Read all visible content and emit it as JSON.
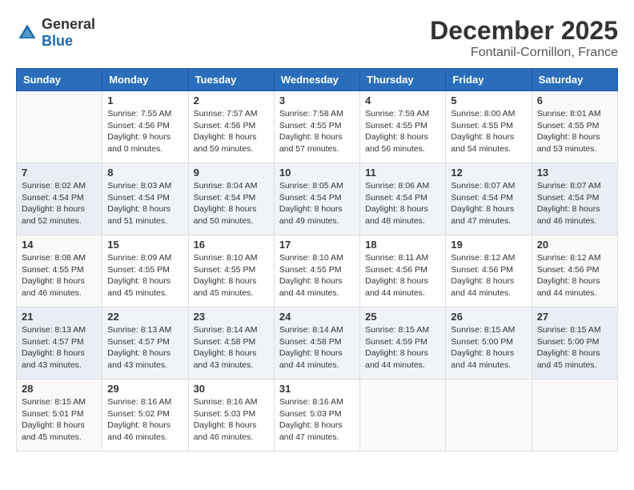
{
  "header": {
    "logo_general": "General",
    "logo_blue": "Blue",
    "title": "December 2025",
    "subtitle": "Fontanil-Cornillon, France"
  },
  "calendar": {
    "weekdays": [
      "Sunday",
      "Monday",
      "Tuesday",
      "Wednesday",
      "Thursday",
      "Friday",
      "Saturday"
    ],
    "rows": [
      [
        {
          "day": "",
          "sunrise": "",
          "sunset": "",
          "daylight": ""
        },
        {
          "day": "1",
          "sunrise": "Sunrise: 7:55 AM",
          "sunset": "Sunset: 4:56 PM",
          "daylight": "Daylight: 9 hours and 0 minutes."
        },
        {
          "day": "2",
          "sunrise": "Sunrise: 7:57 AM",
          "sunset": "Sunset: 4:56 PM",
          "daylight": "Daylight: 8 hours and 59 minutes."
        },
        {
          "day": "3",
          "sunrise": "Sunrise: 7:58 AM",
          "sunset": "Sunset: 4:55 PM",
          "daylight": "Daylight: 8 hours and 57 minutes."
        },
        {
          "day": "4",
          "sunrise": "Sunrise: 7:59 AM",
          "sunset": "Sunset: 4:55 PM",
          "daylight": "Daylight: 8 hours and 56 minutes."
        },
        {
          "day": "5",
          "sunrise": "Sunrise: 8:00 AM",
          "sunset": "Sunset: 4:55 PM",
          "daylight": "Daylight: 8 hours and 54 minutes."
        },
        {
          "day": "6",
          "sunrise": "Sunrise: 8:01 AM",
          "sunset": "Sunset: 4:55 PM",
          "daylight": "Daylight: 8 hours and 53 minutes."
        }
      ],
      [
        {
          "day": "7",
          "sunrise": "Sunrise: 8:02 AM",
          "sunset": "Sunset: 4:54 PM",
          "daylight": "Daylight: 8 hours and 52 minutes."
        },
        {
          "day": "8",
          "sunrise": "Sunrise: 8:03 AM",
          "sunset": "Sunset: 4:54 PM",
          "daylight": "Daylight: 8 hours and 51 minutes."
        },
        {
          "day": "9",
          "sunrise": "Sunrise: 8:04 AM",
          "sunset": "Sunset: 4:54 PM",
          "daylight": "Daylight: 8 hours and 50 minutes."
        },
        {
          "day": "10",
          "sunrise": "Sunrise: 8:05 AM",
          "sunset": "Sunset: 4:54 PM",
          "daylight": "Daylight: 8 hours and 49 minutes."
        },
        {
          "day": "11",
          "sunrise": "Sunrise: 8:06 AM",
          "sunset": "Sunset: 4:54 PM",
          "daylight": "Daylight: 8 hours and 48 minutes."
        },
        {
          "day": "12",
          "sunrise": "Sunrise: 8:07 AM",
          "sunset": "Sunset: 4:54 PM",
          "daylight": "Daylight: 8 hours and 47 minutes."
        },
        {
          "day": "13",
          "sunrise": "Sunrise: 8:07 AM",
          "sunset": "Sunset: 4:54 PM",
          "daylight": "Daylight: 8 hours and 46 minutes."
        }
      ],
      [
        {
          "day": "14",
          "sunrise": "Sunrise: 8:08 AM",
          "sunset": "Sunset: 4:55 PM",
          "daylight": "Daylight: 8 hours and 46 minutes."
        },
        {
          "day": "15",
          "sunrise": "Sunrise: 8:09 AM",
          "sunset": "Sunset: 4:55 PM",
          "daylight": "Daylight: 8 hours and 45 minutes."
        },
        {
          "day": "16",
          "sunrise": "Sunrise: 8:10 AM",
          "sunset": "Sunset: 4:55 PM",
          "daylight": "Daylight: 8 hours and 45 minutes."
        },
        {
          "day": "17",
          "sunrise": "Sunrise: 8:10 AM",
          "sunset": "Sunset: 4:55 PM",
          "daylight": "Daylight: 8 hours and 44 minutes."
        },
        {
          "day": "18",
          "sunrise": "Sunrise: 8:11 AM",
          "sunset": "Sunset: 4:56 PM",
          "daylight": "Daylight: 8 hours and 44 minutes."
        },
        {
          "day": "19",
          "sunrise": "Sunrise: 8:12 AM",
          "sunset": "Sunset: 4:56 PM",
          "daylight": "Daylight: 8 hours and 44 minutes."
        },
        {
          "day": "20",
          "sunrise": "Sunrise: 8:12 AM",
          "sunset": "Sunset: 4:56 PM",
          "daylight": "Daylight: 8 hours and 44 minutes."
        }
      ],
      [
        {
          "day": "21",
          "sunrise": "Sunrise: 8:13 AM",
          "sunset": "Sunset: 4:57 PM",
          "daylight": "Daylight: 8 hours and 43 minutes."
        },
        {
          "day": "22",
          "sunrise": "Sunrise: 8:13 AM",
          "sunset": "Sunset: 4:57 PM",
          "daylight": "Daylight: 8 hours and 43 minutes."
        },
        {
          "day": "23",
          "sunrise": "Sunrise: 8:14 AM",
          "sunset": "Sunset: 4:58 PM",
          "daylight": "Daylight: 8 hours and 43 minutes."
        },
        {
          "day": "24",
          "sunrise": "Sunrise: 8:14 AM",
          "sunset": "Sunset: 4:58 PM",
          "daylight": "Daylight: 8 hours and 44 minutes."
        },
        {
          "day": "25",
          "sunrise": "Sunrise: 8:15 AM",
          "sunset": "Sunset: 4:59 PM",
          "daylight": "Daylight: 8 hours and 44 minutes."
        },
        {
          "day": "26",
          "sunrise": "Sunrise: 8:15 AM",
          "sunset": "Sunset: 5:00 PM",
          "daylight": "Daylight: 8 hours and 44 minutes."
        },
        {
          "day": "27",
          "sunrise": "Sunrise: 8:15 AM",
          "sunset": "Sunset: 5:00 PM",
          "daylight": "Daylight: 8 hours and 45 minutes."
        }
      ],
      [
        {
          "day": "28",
          "sunrise": "Sunrise: 8:15 AM",
          "sunset": "Sunset: 5:01 PM",
          "daylight": "Daylight: 8 hours and 45 minutes."
        },
        {
          "day": "29",
          "sunrise": "Sunrise: 8:16 AM",
          "sunset": "Sunset: 5:02 PM",
          "daylight": "Daylight: 8 hours and 46 minutes."
        },
        {
          "day": "30",
          "sunrise": "Sunrise: 8:16 AM",
          "sunset": "Sunset: 5:03 PM",
          "daylight": "Daylight: 8 hours and 46 minutes."
        },
        {
          "day": "31",
          "sunrise": "Sunrise: 8:16 AM",
          "sunset": "Sunset: 5:03 PM",
          "daylight": "Daylight: 8 hours and 47 minutes."
        },
        {
          "day": "",
          "sunrise": "",
          "sunset": "",
          "daylight": ""
        },
        {
          "day": "",
          "sunrise": "",
          "sunset": "",
          "daylight": ""
        },
        {
          "day": "",
          "sunrise": "",
          "sunset": "",
          "daylight": ""
        }
      ]
    ]
  }
}
